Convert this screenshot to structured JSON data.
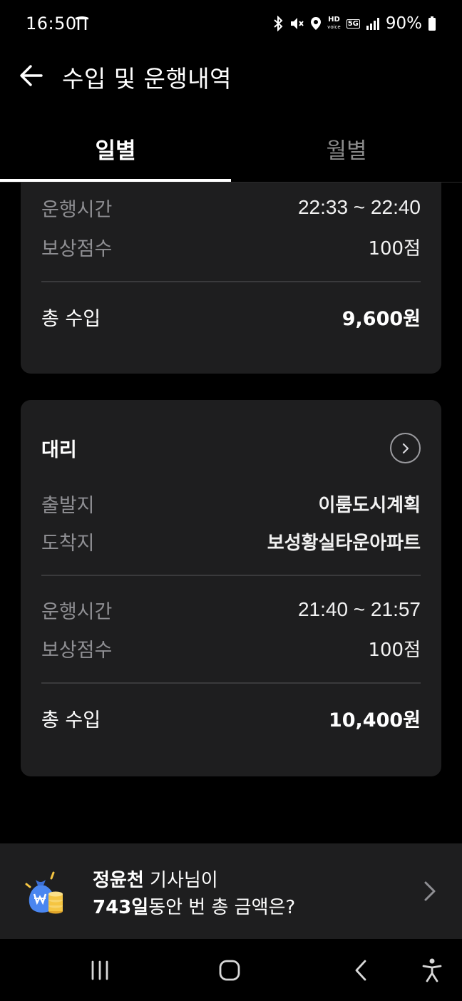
{
  "status_bar": {
    "time": "16:50",
    "battery_percent": "90%",
    "hd_line1": "HD",
    "hd_line2": "voice",
    "network": "5G",
    "icons": [
      "carrier-t-icon",
      "bluetooth-icon",
      "mute-icon",
      "location-icon",
      "hd-voice-icon",
      "5g-icon",
      "signal-icon",
      "battery-icon"
    ]
  },
  "header": {
    "title": "수입 및 운행내역",
    "back_icon": "arrow-left-icon"
  },
  "tabs": [
    {
      "label": "일별",
      "active": true
    },
    {
      "label": "월별",
      "active": false
    }
  ],
  "cards": [
    {
      "time_label": "운행시간",
      "time_value": "22:33 ~ 22:40",
      "points_label": "보상점수",
      "points_value": "100점",
      "total_label": "총 수입",
      "total_value": "9,600원"
    },
    {
      "title": "대리",
      "chevron_icon": "chevron-right-circle-icon",
      "origin_label": "출발지",
      "origin_value": "이룸도시계획",
      "destination_label": "도착지",
      "destination_value": "보성황실타운아파트",
      "time_label": "운행시간",
      "time_value": "21:40 ~ 21:57",
      "points_label": "보상점수",
      "points_value": "100점",
      "total_label": "총 수입",
      "total_value": "10,400원"
    }
  ],
  "banner": {
    "driver_name": "정윤천",
    "line1_suffix": " 기사님이",
    "days": "743일",
    "line2_suffix": "동안 번 총 금액은?",
    "icon": "money-bag-coins-icon",
    "chevron_icon": "chevron-right-icon"
  },
  "nav_bar": {
    "icons": [
      "recent-apps-icon",
      "home-icon",
      "back-icon",
      "accessibility-icon"
    ]
  },
  "colors": {
    "background": "#000000",
    "card": "#1e1e1f",
    "label": "#8f8f93",
    "divider": "#3a3a3c",
    "inactive_tab": "#8a8a8a"
  }
}
